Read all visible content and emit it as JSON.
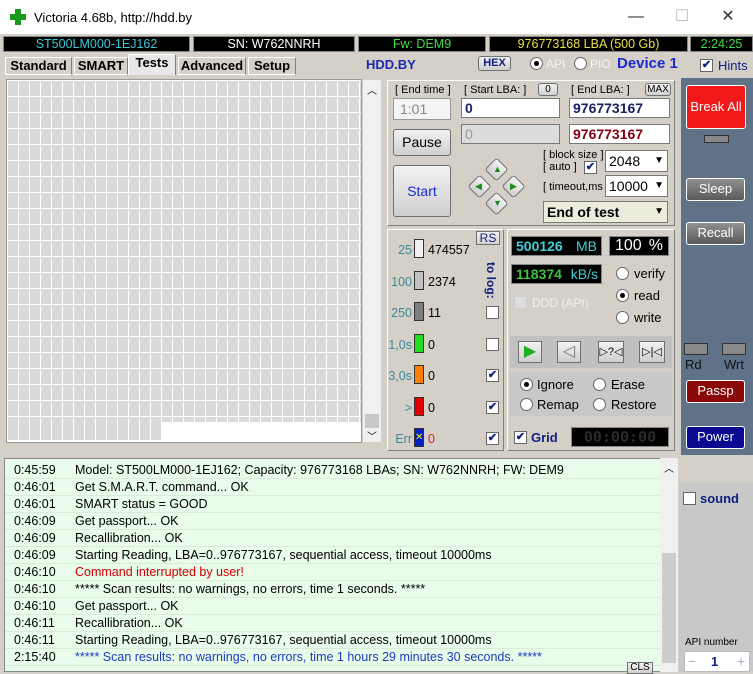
{
  "window": {
    "title": "Victoria 4.68b, http://hdd.by",
    "minimize": "—",
    "maximize": "☐",
    "close": "✕"
  },
  "info": {
    "model": "ST500LM000-1EJ162",
    "serial": "SN: W762NNRH",
    "firmware": "Fw: DEM9",
    "capacity": "976773168 LBA (500 Gb)",
    "clock": "2:24:25"
  },
  "tabs": [
    {
      "label": "Standard"
    },
    {
      "label": "SMART"
    },
    {
      "label": "Tests",
      "active": true
    },
    {
      "label": "Advanced"
    },
    {
      "label": "Setup"
    }
  ],
  "toolbar": {
    "site": "HDD.BY",
    "hex": "HEX",
    "api": "API",
    "pio": "PIO",
    "mode_selected": "API",
    "device": "Device 1",
    "hints": "Hints",
    "hints_checked": true
  },
  "controls": {
    "end_time_label": "[ End time ]",
    "end_time": "1:01",
    "start_lba_label": "[ Start LBA: ]",
    "start_zero": "0",
    "end_lba_label": "[ End LBA: ]",
    "max": "MAX",
    "start_lba": "0",
    "end_lba": "976773167",
    "current_lba": "0",
    "end_lba_current": "976773167",
    "pause": "Pause",
    "start": "Start",
    "block_size_label": "[ block size ]",
    "auto_label": "[ auto ]",
    "auto_checked": true,
    "block_size": "2048",
    "timeout_label": "[ timeout,ms ]",
    "timeout": "10000",
    "end_action": "End of test"
  },
  "stats": {
    "rs": "RS",
    "to_log": "to log:",
    "rows": [
      {
        "label": "25",
        "count": "474557",
        "color": "#f0f0f0",
        "log": null
      },
      {
        "label": "100",
        "count": "2374",
        "color": "#c0c0c0",
        "log": null
      },
      {
        "label": "250",
        "count": "11",
        "color": "#808080",
        "log": false
      },
      {
        "label": "1,0s",
        "count": "0",
        "color": "#22dd22",
        "log": false
      },
      {
        "label": "3,0s",
        "count": "0",
        "color": "#ff8000",
        "log": true
      },
      {
        "label": ">",
        "count": "0",
        "color": "#e00000",
        "log": true
      },
      {
        "label": "Err",
        "count": "0",
        "color": "#0020c0",
        "log": true
      }
    ]
  },
  "progress": {
    "mb": "500126",
    "mb_unit": "MB",
    "percent": "100",
    "percent_unit": "%",
    "speed": "118374",
    "speed_unit": "kB/s",
    "ddd": "DDD (API)",
    "verify": "verify",
    "read": "read",
    "write": "write",
    "selected": "read"
  },
  "actions": {
    "ignore": "Ignore",
    "erase": "Erase",
    "remap": "Remap",
    "restore": "Restore",
    "selected": "Ignore",
    "grid": "Grid",
    "grid_checked": true,
    "timer": "00:00:00"
  },
  "side": {
    "break_all": "Break All",
    "sleep": "Sleep",
    "recall": "Recall",
    "rd": "Rd",
    "wrt": "Wrt",
    "passp": "Passp",
    "power": "Power",
    "sound": "sound",
    "api_number_label": "API number",
    "api_number": "1",
    "minus": "−",
    "plus": "+"
  },
  "log": {
    "cls": "CLS",
    "entries": [
      {
        "time": "0:45:59",
        "msg": "Model: ST500LM000-1EJ162; Capacity: 976773168 LBAs; SN: W762NNRH; FW: DEM9",
        "color": "#000000"
      },
      {
        "time": "0:46:01",
        "msg": "Get S.M.A.R.T. command... OK",
        "color": "#000000"
      },
      {
        "time": "0:46:01",
        "msg": "SMART status = GOOD",
        "color": "#000000"
      },
      {
        "time": "0:46:09",
        "msg": "Get passport... OK",
        "color": "#000000"
      },
      {
        "time": "0:46:09",
        "msg": "Recallibration... OK",
        "color": "#000000"
      },
      {
        "time": "0:46:09",
        "msg": "Starting Reading, LBA=0..976773167, sequential access, timeout 10000ms",
        "color": "#000000"
      },
      {
        "time": "0:46:10",
        "msg": "Command interrupted by user!",
        "color": "#d00000"
      },
      {
        "time": "0:46:10",
        "msg": "***** Scan results: no warnings, no errors, time 1 seconds.  *****",
        "color": "#000000"
      },
      {
        "time": "0:46:10",
        "msg": "Get passport... OK",
        "color": "#000000"
      },
      {
        "time": "0:46:11",
        "msg": "Recallibration... OK",
        "color": "#000000"
      },
      {
        "time": "0:46:11",
        "msg": "Starting Reading, LBA=0..976773167, sequential access, timeout 10000ms",
        "color": "#000000"
      },
      {
        "time": "2:15:40",
        "msg": "***** Scan results: no warnings, no errors, time 1 hours 29 minutes 30 seconds.  *****",
        "color": "#1a3cc0"
      }
    ]
  }
}
